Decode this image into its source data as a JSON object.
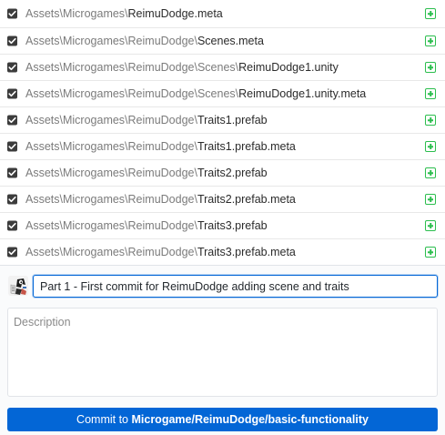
{
  "files": [
    {
      "dir": "Assets\\Microgames\\",
      "name": "ReimuDodge.meta",
      "checked": true,
      "status": "added"
    },
    {
      "dir": "Assets\\Microgames\\ReimuDodge\\",
      "name": "Scenes.meta",
      "checked": true,
      "status": "added"
    },
    {
      "dir": "Assets\\Microgames\\ReimuDodge\\Scenes\\",
      "name": "ReimuDodge1.unity",
      "checked": true,
      "status": "added"
    },
    {
      "dir": "Assets\\Microgames\\ReimuDodge\\Scenes\\",
      "name": "ReimuDodge1.unity.meta",
      "checked": true,
      "status": "added"
    },
    {
      "dir": "Assets\\Microgames\\ReimuDodge\\",
      "name": "Traits1.prefab",
      "checked": true,
      "status": "added"
    },
    {
      "dir": "Assets\\Microgames\\ReimuDodge\\",
      "name": "Traits1.prefab.meta",
      "checked": true,
      "status": "added"
    },
    {
      "dir": "Assets\\Microgames\\ReimuDodge\\",
      "name": "Traits2.prefab",
      "checked": true,
      "status": "added"
    },
    {
      "dir": "Assets\\Microgames\\ReimuDodge\\",
      "name": "Traits2.prefab.meta",
      "checked": true,
      "status": "added"
    },
    {
      "dir": "Assets\\Microgames\\ReimuDodge\\",
      "name": "Traits3.prefab",
      "checked": true,
      "status": "added"
    },
    {
      "dir": "Assets\\Microgames\\ReimuDodge\\",
      "name": "Traits3.prefab.meta",
      "checked": true,
      "status": "added"
    }
  ],
  "commit": {
    "summary_value": "Part 1 - First commit for ReimuDodge adding scene and traits",
    "description_placeholder": "Description",
    "button_prefix": "Commit to ",
    "branch": "Microgame/ReimuDodge/basic-functionality"
  },
  "colors": {
    "accent": "#0366d6",
    "added": "#2cbe4e"
  },
  "icons": {
    "checkbox": "checkbox-checked-icon",
    "status": "file-added-icon",
    "avatar": "user-avatar"
  }
}
